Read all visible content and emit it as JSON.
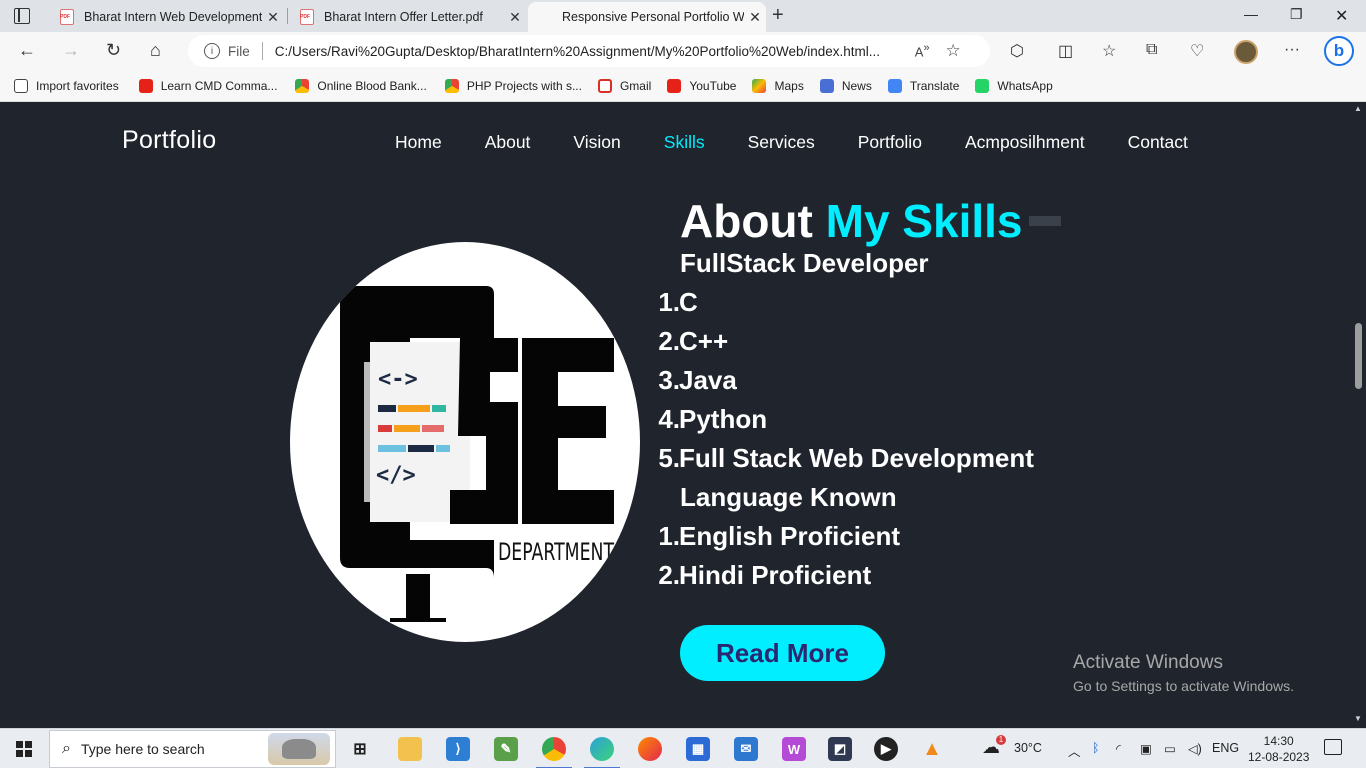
{
  "browser": {
    "tabs": [
      {
        "title": "Bharat Intern Web Development",
        "type": "pdf"
      },
      {
        "title": "Bharat Intern Offer Letter.pdf",
        "type": "pdf"
      },
      {
        "title": "Responsive Personal Portfolio We",
        "type": "page"
      }
    ],
    "address": {
      "info_label": "i",
      "scheme_label": "File",
      "url": "C:/Users/Ravi%20Gupta/Desktop/BharatIntern%20Assignment/My%20Portfolio%20Web/index.html..."
    },
    "favorites": [
      {
        "label": "Import favorites",
        "icon": "import-icon"
      },
      {
        "label": "Learn CMD Comma...",
        "icon": "youtube-icon"
      },
      {
        "label": "Online Blood Bank...",
        "icon": "drive-icon"
      },
      {
        "label": "PHP Projects with s...",
        "icon": "drive-icon"
      },
      {
        "label": "Gmail",
        "icon": "gmail-icon"
      },
      {
        "label": "YouTube",
        "icon": "youtube-icon"
      },
      {
        "label": "Maps",
        "icon": "maps-icon"
      },
      {
        "label": "News",
        "icon": "news-icon"
      },
      {
        "label": "Translate",
        "icon": "translate-icon"
      },
      {
        "label": "WhatsApp",
        "icon": "whatsapp-icon"
      }
    ]
  },
  "site": {
    "logo": "Portfolio",
    "nav": [
      "Home",
      "About",
      "Vision",
      "Skills",
      "Services",
      "Portfolio",
      "Acmposilhment",
      "Contact"
    ],
    "active_nav": "Skills",
    "accent": "#00eeff",
    "background": "#1f242d"
  },
  "skills": {
    "heading_main": "About",
    "heading_highlight": "My Skills",
    "subtitle": "FullStack Developer",
    "list": [
      {
        "num": "1.",
        "text": "C"
      },
      {
        "num": "2.",
        "text": "C++"
      },
      {
        "num": "3.",
        "text": "Java"
      },
      {
        "num": "4.",
        "text": "Python"
      },
      {
        "num": "5.",
        "text": "Full Stack Web Development"
      }
    ],
    "languages_title": "Language Known",
    "languages": [
      {
        "num": "1.",
        "text": "English Proficient"
      },
      {
        "num": "2.",
        "text": "Hindi Proficient"
      }
    ],
    "button": "Read More"
  },
  "image": {
    "caption": "DEPARTMENT",
    "code_top": "<->",
    "code_bottom": "</>"
  },
  "watermark": {
    "title": "Activate Windows",
    "subtitle": "Go to Settings to activate Windows."
  },
  "taskbar": {
    "search_placeholder": "Type here to search",
    "temperature": "30°C",
    "language": "ENG",
    "time": "14:30",
    "date": "12-08-2023",
    "weather_badge": "1"
  }
}
